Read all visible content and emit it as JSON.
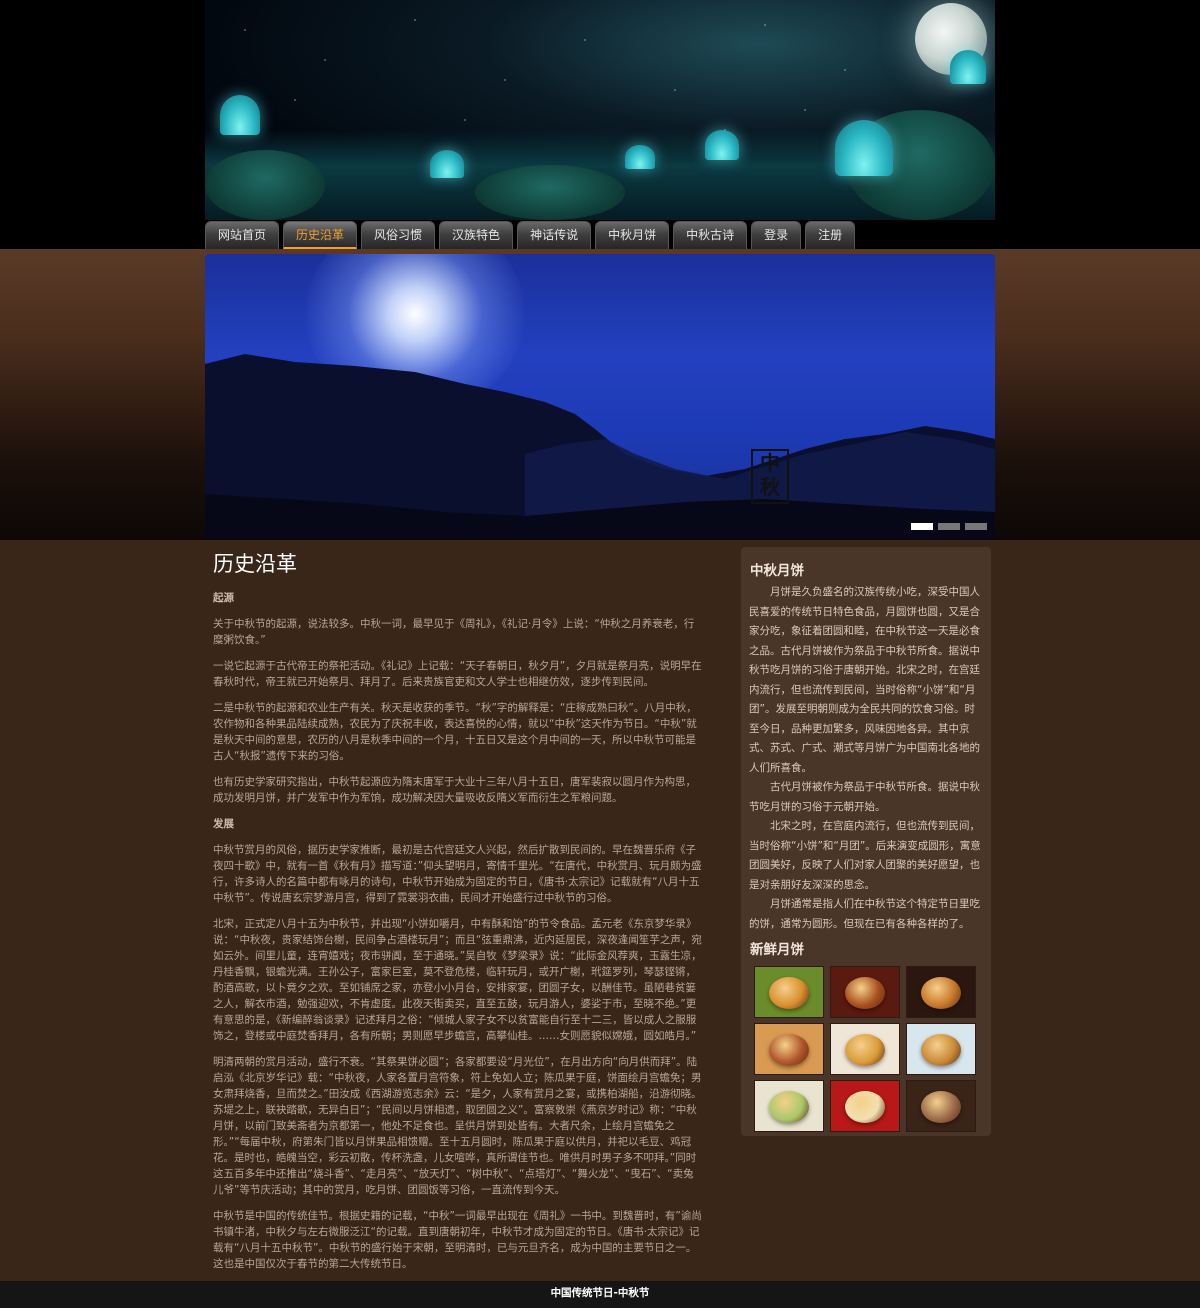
{
  "nav": {
    "items": [
      "网站首页",
      "历史沿革",
      "风俗习惯",
      "汉族特色",
      "神话传说",
      "中秋月饼",
      "中秋古诗",
      "登录",
      "注册"
    ],
    "active_index": 1
  },
  "slider": {
    "stamp_text": "中秋",
    "active_slide": 1,
    "total_slides": 3
  },
  "main": {
    "title": "历史沿革",
    "sections": [
      {
        "heading": "起源"
      },
      {
        "p": "关于中秋节的起源，说法较多。中秋一词，最早见于《周礼》，《礼记·月令》上说：“仲秋之月养衰老，行糜粥饮食。”"
      },
      {
        "p": "一说它起源于古代帝王的祭祀活动。《礼记》上记载：“天子春朝日，秋夕月”，夕月就是祭月亮，说明早在春秋时代，帝王就已开始祭月、拜月了。后来贵族官吏和文人学士也相继仿效，逐步传到民间。"
      },
      {
        "p": "二是中秋节的起源和农业生产有关。秋天是收获的季节。“秋”字的解释是：“庄稼成熟曰秋”。八月中秋，农作物和各种果品陆续成熟，农民为了庆祝丰收，表达喜悦的心情，就以“中秋”这天作为节日。“中秋”就是秋天中间的意思，农历的八月是秋季中间的一个月，十五日又是这个月中间的一天，所以中秋节可能是古人“秋报”遗传下来的习俗。"
      },
      {
        "p": "也有历史学家研究指出，中秋节起源应为隋末唐军于大业十三年八月十五日，唐军裴寂以圆月作为构思，成功发明月饼，并广发军中作为军饷，成功解决因大量吸收反隋义军而衍生之军粮问题。"
      },
      {
        "heading": "发展"
      },
      {
        "p": "中秋节赏月的风俗，据历史学家推断，最初是古代宫廷文人兴起，然后扩散到民间的。早在魏晋乐府《子夜四十歌》中，就有一首《秋有月》描写道：”仰头望明月，寄情千里光。“在唐代，中秋赏月、玩月颇为盛行，许多诗人的名篇中都有咏月的诗句，中秋节开始成为固定的节日，《唐书·太宗记》记载就有“八月十五中秋节”。传说唐玄宗梦游月宫，得到了霓裳羽衣曲，民间才开始盛行过中秋节的习俗。"
      },
      {
        "p": "北宋，正式定八月十五为中秋节，并出现“小饼如嚼月，中有酥和饴”的节令食品。孟元老《东京梦华录》说：“中秋夜，贵家结饰台榭，民间争占酒楼玩月”；而且“弦重鼎沸，近内延居民，深夜逢闻笙芋之声，宛如云外。间里儿童，连宵嬉戏；夜市骈阗，至于通晓。”吴自牧《梦梁录》说：“此际金风荐爽，玉露生凉，丹桂香飘，银蟾光满。王孙公子，富家巨室，莫不登危楼，临轩玩月，或开广榭，玳筵罗列，琴瑟铿锵，酌酒高歌，以卜竟夕之欢。至如铺席之家，亦登小小月台，安排家宴，团圆子女，以酬佳节。虽陋巷贫篓之人，解衣市酒，勉强迎欢，不肯虚度。此夜天街卖买，直至五鼓，玩月游人，婆娑于市，至晓不绝。”更有意思的是，《新编醉翁谈录》记述拜月之俗：“倾城人家子女不以贫富能自行至十二三，皆以成人之服服饰之，登楼或中庭焚香拜月，各有所朝；男则愿早步蟾宫，高攀仙桂。……女则愿貌似嫦娥，圆如皓月。”"
      },
      {
        "p": "明清两朝的赏月活动，盛行不衰。“其祭果饼必圆”；各家都要设“月光位”，在月出方向“向月供而拜”。陆启泓《北京岁华记》载：“中秋夜，人家各置月宫符象，符上免如人立；陈瓜果于庭，饼面绘月宫蟾免；男女肃拜烧香，旦而焚之。”田汝成《西湖游览志余》云：“是夕，人家有赏月之宴，或携柏湖船，沿游彻晓。苏堤之上，联袂踏歌，无异白日”；“民间以月饼相遗，取团圆之义”。富察敦崇《燕京岁时记》称：“中秋月饼，以前门致美斋者为京都第一，他处不足食也。呈供月饼到处皆有。大者尺余，上绘月宫蟾免之形。”“每届中秋，府第朱门皆以月饼果品相馈赠。至十五月圆时，陈瓜果于庭以供月，并祀以毛豆、鸡冠花。是时也，皓魄当空，彩云初散，传杯洗盏，儿女喧哗，真所谓佳节也。唯供月时男子多不叩拜。”同时这五百多年中还推出“烧斗香”、“走月亮”、“放天灯”、“树中秋”、“点塔灯”、“舞火龙”、“曳石”、“卖兔儿爷”等节庆活动；其中的赏月，吃月饼、团圆饭等习俗，一直流传到今天。"
      },
      {
        "p": "中秋节是中国的传统佳节。根据史籍的记载，“中秋”一词最早出现在《周礼》一书中。到魏晋时，有”谕尚书镇牛渚，中秋夕与左右微服泛江“的记载。直到唐朝初年，中秋节才成为固定的节日。《唐书·太宗记》记载有“八月十五中秋节”。中秋节的盛行始于宋朝，至明清时，已与元旦齐名，成为中国的主要节日之一。这也是中国仅次于春节的第二大传统节日。"
      }
    ]
  },
  "sidebar": {
    "mooncake_title": "中秋月饼",
    "paragraphs": [
      "月饼是久负盛名的汉族传统小吃，深受中国人民喜爱的传统节日特色食品，月圆饼也圆，又是合家分吃，象征着团圆和睦，在中秋节这一天是必食之品。古代月饼被作为祭品于中秋节所食。据说中秋节吃月饼的习俗于唐朝开始。北宋之时，在宫廷内流行，但也流传到民间，当时俗称“小饼”和“月团”。发展至明朝则成为全民共同的饮食习俗。时至今日，品种更加繁多，风味因地各异。其中京式、苏式、广式、潮式等月饼广为中国南北各地的人们所喜食。",
      "古代月饼被作为祭品于中秋节所食。据说中秋节吃月饼的习俗于元朝开始。",
      "北宋之时，在宫庭内流行，但也流传到民间，当时俗称“小饼”和“月团”。后来演变成圆形，寓意团圆美好，反映了人们对家人团聚的美好愿望，也是对亲朋好友深深的思念。",
      "月饼通常是指人们在中秋节这个特定节日里吃的饼，通常为圆形。但现在已有各种各样的了。"
    ],
    "fresh_title": "新鲜月饼",
    "thumbs": [
      {
        "icon": "mooncake-photo",
        "bg": "#6b8c2a",
        "cake": "#d9902f"
      },
      {
        "icon": "mooncake-photo",
        "bg": "#5a1a10",
        "cake": "#a8501e"
      },
      {
        "icon": "mooncake-photo",
        "bg": "#2a1810",
        "cake": "#c9782a"
      },
      {
        "icon": "mooncake-photo",
        "bg": "#d99a52",
        "cake": "#b0552a"
      },
      {
        "icon": "mooncake-photo",
        "bg": "#f0e6d8",
        "cake": "#d99c3a"
      },
      {
        "icon": "mooncake-photo",
        "bg": "#d8e6ee",
        "cake": "#c98a3a"
      },
      {
        "icon": "mooncake-photo",
        "bg": "#e8e4d0",
        "cake": "#a9c86a"
      },
      {
        "icon": "mooncake-photo",
        "bg": "#b81818",
        "cake": "#f2e0b0"
      },
      {
        "icon": "mooncake-photo",
        "bg": "#3a2418",
        "cake": "#9a6a4a"
      }
    ]
  },
  "footer": {
    "text": "中国传统节日-中秋节"
  }
}
